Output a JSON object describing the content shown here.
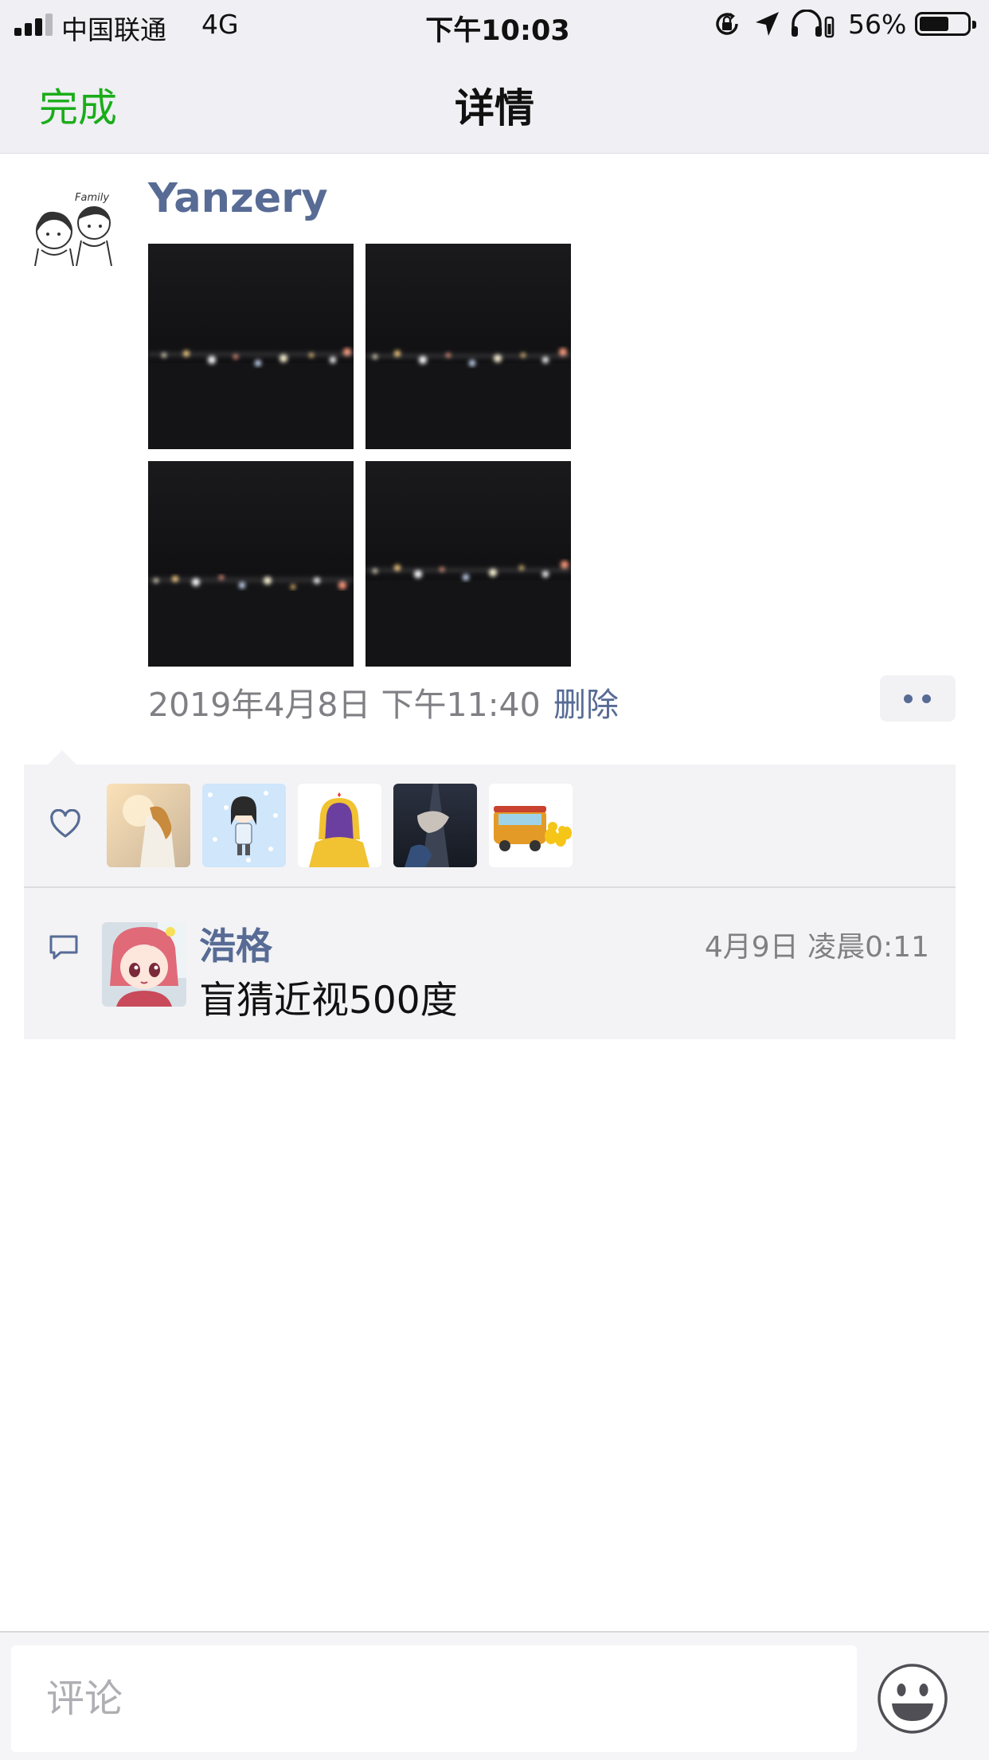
{
  "status_bar": {
    "carrier": "中国联通",
    "network": "4G",
    "time": "下午10:03",
    "battery_percent": "56%",
    "battery_level": 0.56,
    "icons": [
      "signal-icon",
      "orientation-lock-icon",
      "location-arrow-icon",
      "headphones-icon"
    ]
  },
  "nav": {
    "done_label": "完成",
    "title": "详情"
  },
  "post": {
    "author": "Yanzery",
    "photo_count": 4,
    "time": "2019年4月8日 下午11:40",
    "delete_label": "删除",
    "more_icon": "more-dots-icon"
  },
  "likes": {
    "icon": "heart-icon",
    "count": 5
  },
  "comments": [
    {
      "icon": "comment-bubble-icon",
      "author": "浩格",
      "time": "4月9日 凌晨0:11",
      "text": "盲猜近视500度"
    }
  ],
  "comment_bar": {
    "placeholder": "评论",
    "emoji_icon": "smiley-face-icon"
  },
  "colors": {
    "accent_green": "#1aad19",
    "link_blue": "#576b95",
    "header_bg": "#efeff4",
    "interaction_bg": "#f3f3f5"
  }
}
